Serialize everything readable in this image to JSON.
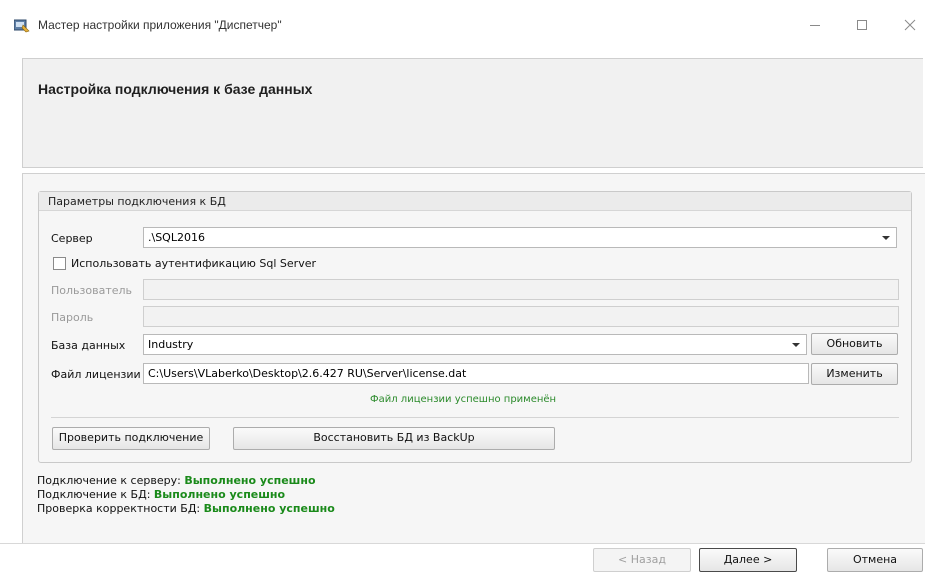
{
  "window": {
    "title": "Мастер настройки приложения \"Диспетчер\""
  },
  "header": {
    "title": "Настройка подключения к базе данных"
  },
  "group": {
    "title": "Параметры подключения к БД",
    "server_label": "Сервер",
    "server_value": ".\\SQL2016",
    "sql_auth_label": "Использовать аутентификацию Sql Server",
    "sql_auth_checked": false,
    "user_label": "Пользователь",
    "user_value": "",
    "password_label": "Пароль",
    "password_value": "",
    "database_label": "База данных",
    "database_value": "Industry",
    "refresh_button": "Обновить",
    "license_label": "Файл лицензии",
    "license_value": "C:\\Users\\VLaberko\\Desktop\\2.6.427 RU\\Server\\license.dat",
    "change_button": "Изменить",
    "license_message": "Файл лицензии успешно применён",
    "check_button": "Проверить подключение",
    "restore_button": "Восстановить БД из BackUp"
  },
  "status": {
    "server_label": "Подключение к серверу:",
    "server_value": "Выполнено успешно",
    "db_label": "Подключение к БД:",
    "db_value": "Выполнено успешно",
    "check_label": "Проверка корректности БД:",
    "check_value": "Выполнено успешно"
  },
  "footer": {
    "back_button": "< Назад",
    "next_button": "Далее >",
    "cancel_button": "Отмена"
  },
  "colors": {
    "success_green": "#1a8a1a",
    "license_ok_green": "#2b8a2b"
  }
}
